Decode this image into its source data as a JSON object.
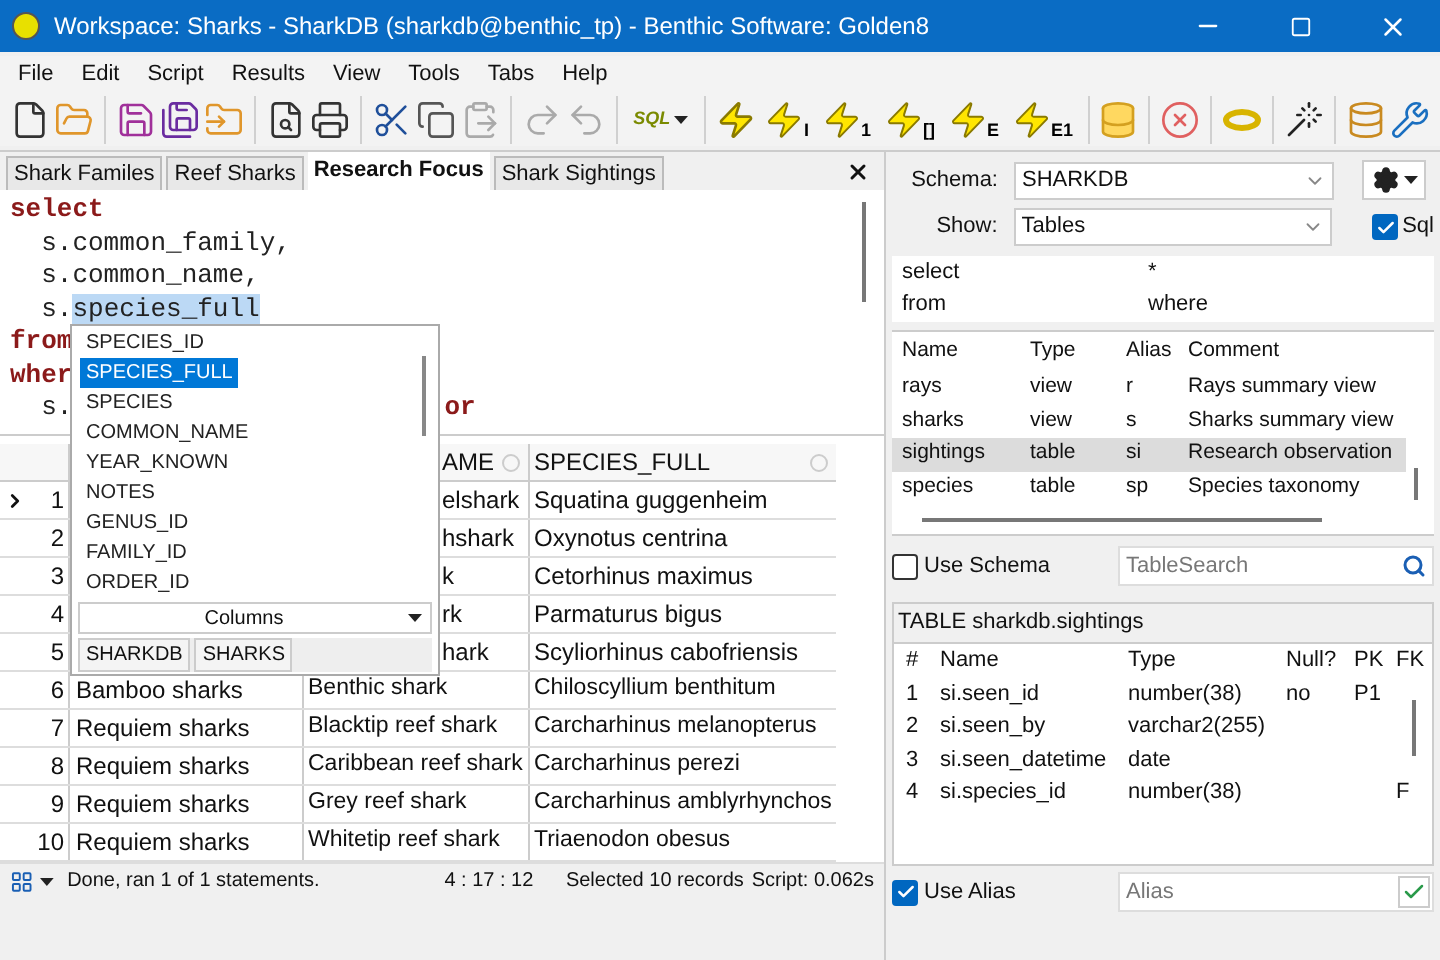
{
  "window": {
    "title": "Workspace: Sharks - SharkDB (sharkdb@benthic_tp) - Benthic Software: Golden8"
  },
  "menu": [
    "File",
    "Edit",
    "Script",
    "Results",
    "View",
    "Tools",
    "Tabs",
    "Help"
  ],
  "toolbar": {
    "sql_mark": "SQL",
    "bolt_marks": [
      "I",
      "1",
      "[]",
      "E",
      "E1"
    ]
  },
  "tabs": [
    {
      "label": "Shark Familes",
      "selected": false
    },
    {
      "label": "Reef Sharks",
      "selected": false
    },
    {
      "label": "Research Focus",
      "selected": true
    },
    {
      "label": "Shark Sightings",
      "selected": false
    }
  ],
  "editor": {
    "lines": [
      {
        "parts": [
          {
            "text": "select",
            "kind": "keyword"
          }
        ]
      },
      {
        "parts": [
          {
            "text": "  s.common_family,",
            "kind": "plain"
          }
        ]
      },
      {
        "parts": [
          {
            "text": "  s.common_name,",
            "kind": "plain"
          }
        ]
      },
      {
        "parts": [
          {
            "text": "  s.",
            "kind": "plain"
          },
          {
            "text": "species_full",
            "kind": "selected"
          }
        ]
      },
      {
        "parts": [
          {
            "text": "from",
            "kind": "keyword"
          }
        ]
      },
      {
        "parts": [
          {
            "text": "wher",
            "kind": "keyword"
          }
        ]
      },
      {
        "parts": [
          {
            "text": "  s.",
            "kind": "plain"
          },
          {
            "text": "or",
            "kind": "keyword_after_popup"
          }
        ]
      }
    ]
  },
  "autocomplete": {
    "items": [
      {
        "label": "SPECIES_ID",
        "selected": false
      },
      {
        "label": "SPECIES_FULL",
        "selected": true
      },
      {
        "label": "SPECIES",
        "selected": false
      },
      {
        "label": "COMMON_NAME",
        "selected": false
      },
      {
        "label": "YEAR_KNOWN",
        "selected": false
      },
      {
        "label": "NOTES",
        "selected": false
      },
      {
        "label": "GENUS_ID",
        "selected": false
      },
      {
        "label": "FAMILY_ID",
        "selected": false
      },
      {
        "label": "ORDER_ID",
        "selected": false
      }
    ],
    "mode": "Columns",
    "tabs": [
      "SHARKDB",
      "SHARKS"
    ]
  },
  "results": {
    "columns": [
      "AME",
      "SPECIES_FULL"
    ],
    "rows": [
      {
        "num": "1",
        "current": true,
        "covered": true,
        "cells": [
          "elshark",
          "Squatina guggenheim"
        ]
      },
      {
        "num": "2",
        "current": false,
        "covered": true,
        "cells": [
          "hshark",
          "Oxynotus centrina"
        ]
      },
      {
        "num": "3",
        "current": false,
        "covered": true,
        "cells": [
          "k",
          "Cetorhinus maximus"
        ]
      },
      {
        "num": "4",
        "current": false,
        "covered": true,
        "cells": [
          "rk",
          "Parmaturus bigus"
        ]
      },
      {
        "num": "5",
        "current": false,
        "covered": true,
        "cells": [
          "hark",
          "Scyliorhinus cabofriensis"
        ]
      },
      {
        "num": "6",
        "current": false,
        "covered": false,
        "cells": [
          "Bamboo sharks",
          "Benthic shark",
          "Chiloscyllium benthitum"
        ]
      },
      {
        "num": "7",
        "current": false,
        "covered": false,
        "cells": [
          "Requiem sharks",
          "Blacktip reef shark",
          "Carcharhinus melanopterus"
        ]
      },
      {
        "num": "8",
        "current": false,
        "covered": false,
        "cells": [
          "Requiem sharks",
          "Caribbean reef shark",
          "Carcharhinus perezi"
        ]
      },
      {
        "num": "9",
        "current": false,
        "covered": false,
        "cells": [
          "Requiem sharks",
          "Grey reef shark",
          "Carcharhinus amblyrhynchos"
        ]
      },
      {
        "num": "10",
        "current": false,
        "covered": false,
        "cells": [
          "Requiem sharks",
          "Whitetip reef shark",
          "Triaenodon obesus"
        ]
      }
    ]
  },
  "status_bar": {
    "message": "Done, ran 1 of 1 statements.",
    "position": "4 : 17 : 12",
    "selection": "Selected 10 records",
    "timing": "Script: 0.062s"
  },
  "schema_panel": {
    "schema_label": "Schema:",
    "schema_value": "SHARKDB",
    "show_label": "Show:",
    "show_value": "Tables",
    "sql_checkbox": {
      "label": "Sql",
      "checked": true
    },
    "keywords": [
      [
        "select",
        "*"
      ],
      [
        "from",
        "where"
      ]
    ],
    "tables": {
      "columns": [
        "Name",
        "Type",
        "Alias",
        "Comment"
      ],
      "rows": [
        {
          "cells": [
            "rays",
            "view",
            "r",
            "Rays summary view"
          ],
          "selected": false
        },
        {
          "cells": [
            "sharks",
            "view",
            "s",
            "Sharks summary view"
          ],
          "selected": false
        },
        {
          "cells": [
            "sightings",
            "table",
            "si",
            "Research observation"
          ],
          "selected": true
        },
        {
          "cells": [
            "species",
            "table",
            "sp",
            "Species taxonomy"
          ],
          "selected": false
        }
      ]
    },
    "use_schema": {
      "label": "Use Schema",
      "checked": false
    },
    "table_search": {
      "placeholder": "TableSearch"
    },
    "detail": {
      "title": "TABLE sharkdb.sightings",
      "columns": [
        "#",
        "Name",
        "Type",
        "Null?",
        "PK",
        "FK"
      ],
      "rows": [
        [
          "1",
          "si.seen_id",
          "number(38)",
          "no",
          "P1",
          ""
        ],
        [
          "2",
          "si.seen_by",
          "varchar2(255)",
          "",
          "",
          ""
        ],
        [
          "3",
          "si.seen_datetime",
          "date",
          "",
          "",
          ""
        ],
        [
          "4",
          "si.species_id",
          "number(38)",
          "",
          "",
          "F"
        ]
      ]
    },
    "use_alias": {
      "label": "Use Alias",
      "checked": true
    },
    "alias": {
      "placeholder": "Alias"
    }
  }
}
